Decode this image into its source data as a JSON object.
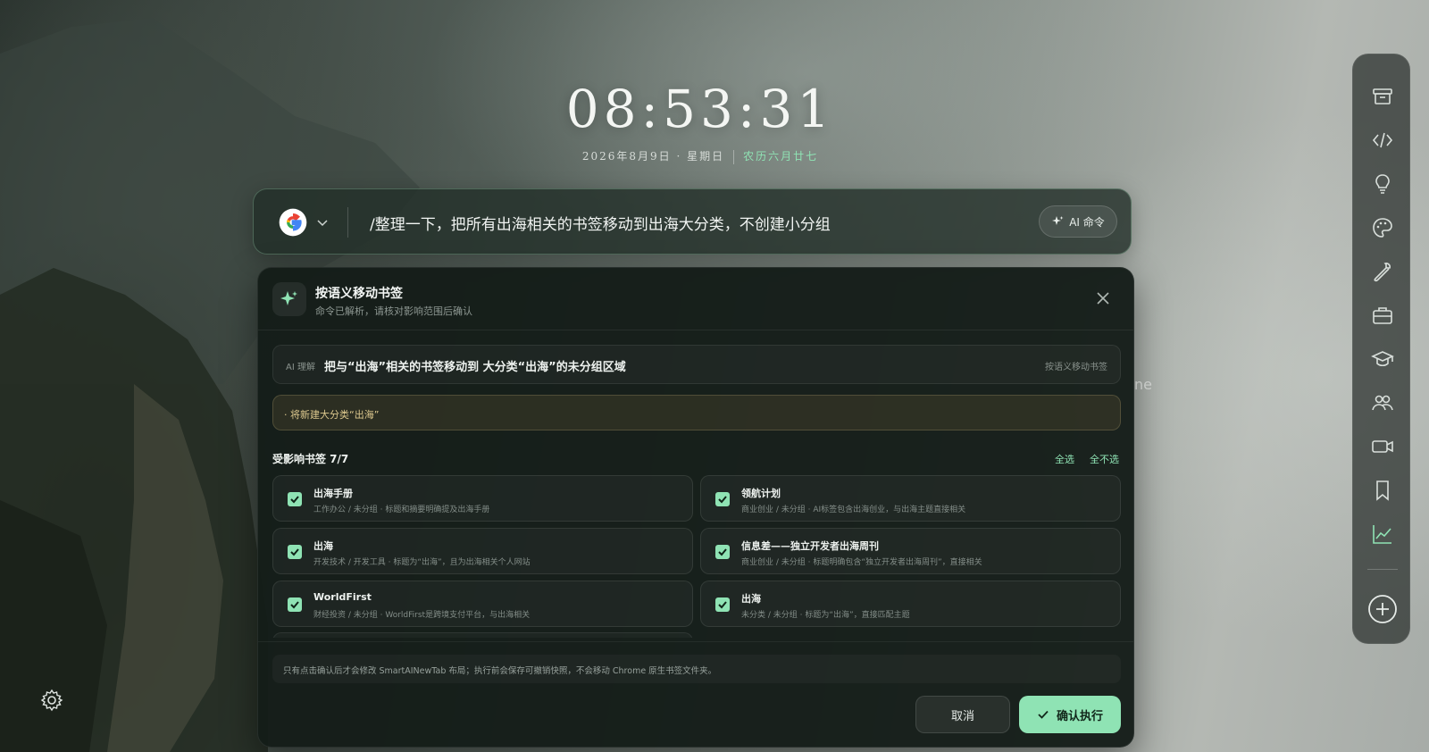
{
  "clock": {
    "time": "08:53:31"
  },
  "date": {
    "solar": "2026年8月9日 · 星期日",
    "lunar": "农历六月廿七"
  },
  "search": {
    "engine_icon": "google-g-logo",
    "query": "/整理一下，把所有出海相关的书签移动到出海大分类，不创建小分组",
    "ai_button_label": "AI 命令"
  },
  "modal": {
    "title": "按语义移动书签",
    "subtitle": "命令已解析，请核对影响范围后确认",
    "ai_tag": "AI 理解",
    "ai_text": "把与“出海”相关的书签移动到 大分类“出海”的未分组区域",
    "ai_action": "按语义移动书签",
    "warning": "· 将新建大分类“出海”",
    "affected_title": "受影响书签 7/7",
    "select_all": "全选",
    "select_none": "全不选",
    "bookmarks": [
      {
        "title": "出海手册",
        "desc": "工作办公 / 未分组 · 标题和摘要明确提及出海手册",
        "checked": true
      },
      {
        "title": "领航计划",
        "desc": "商业创业 / 未分组 · AI标签包含出海创业，与出海主题直接相关",
        "checked": true
      },
      {
        "title": "出海",
        "desc": "开发技术 / 开发工具 · 标题为“出海”，且为出海相关个人网站",
        "checked": true
      },
      {
        "title": "信息差——独立开发者出海周刊",
        "desc": "商业创业 / 未分组 · 标题明确包含“独立开发者出海周刊”，直接相关",
        "checked": true
      },
      {
        "title": "WorldFirst",
        "desc": "财经投资 / 未分组 · WorldFirst是跨境支付平台，与出海相关",
        "checked": true
      },
      {
        "title": "出海",
        "desc": "未分类 / 未分组 · 标题为“出海”，直接匹配主题",
        "checked": true
      }
    ],
    "notice": "只有点击确认后才会修改 SmartAINewTab 布局；执行前会保存可撤销快照，不会移动 Chrome 原生书签文件夹。",
    "cancel_label": "取消",
    "confirm_label": "确认执行"
  },
  "background_peek_text": "ne",
  "dock": {
    "items": [
      "archive-icon",
      "code-icon",
      "lightbulb-icon",
      "palette-icon",
      "wrench-icon",
      "briefcase-icon",
      "graduation-cap-icon",
      "users-icon",
      "video-icon",
      "bookmark-icon",
      "chart-line-icon"
    ],
    "add_icon": "plus-circle-icon"
  },
  "colors": {
    "accent": "#8fe3b4",
    "panel": "#141c18",
    "warning_text": "#dcc88e"
  }
}
